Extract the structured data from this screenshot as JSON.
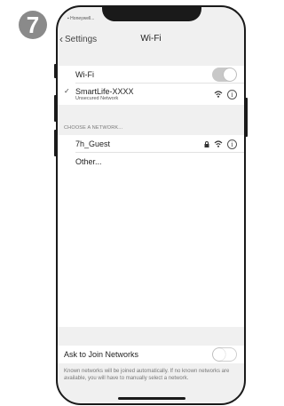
{
  "step_number": "7",
  "status_bar": {
    "carrier": "Honeywell..."
  },
  "navbar": {
    "back_label": "Settings",
    "title": "Wi-Fi"
  },
  "wifi_toggle": {
    "label": "Wi-Fi",
    "state": "on"
  },
  "connected_network": {
    "name": "SmartLife-XXXX",
    "subtitle": "Unsecured Network"
  },
  "choose_header": "CHOOSE A NETWORK...",
  "networks": [
    {
      "name": "7h_Guest",
      "locked": true
    },
    {
      "name": "Other..."
    }
  ],
  "ask_to_join": {
    "label": "Ask to Join Networks",
    "state": "off",
    "description": "Known networks will be joined automatically. If no known networks are available, you will have to manually select a network."
  }
}
